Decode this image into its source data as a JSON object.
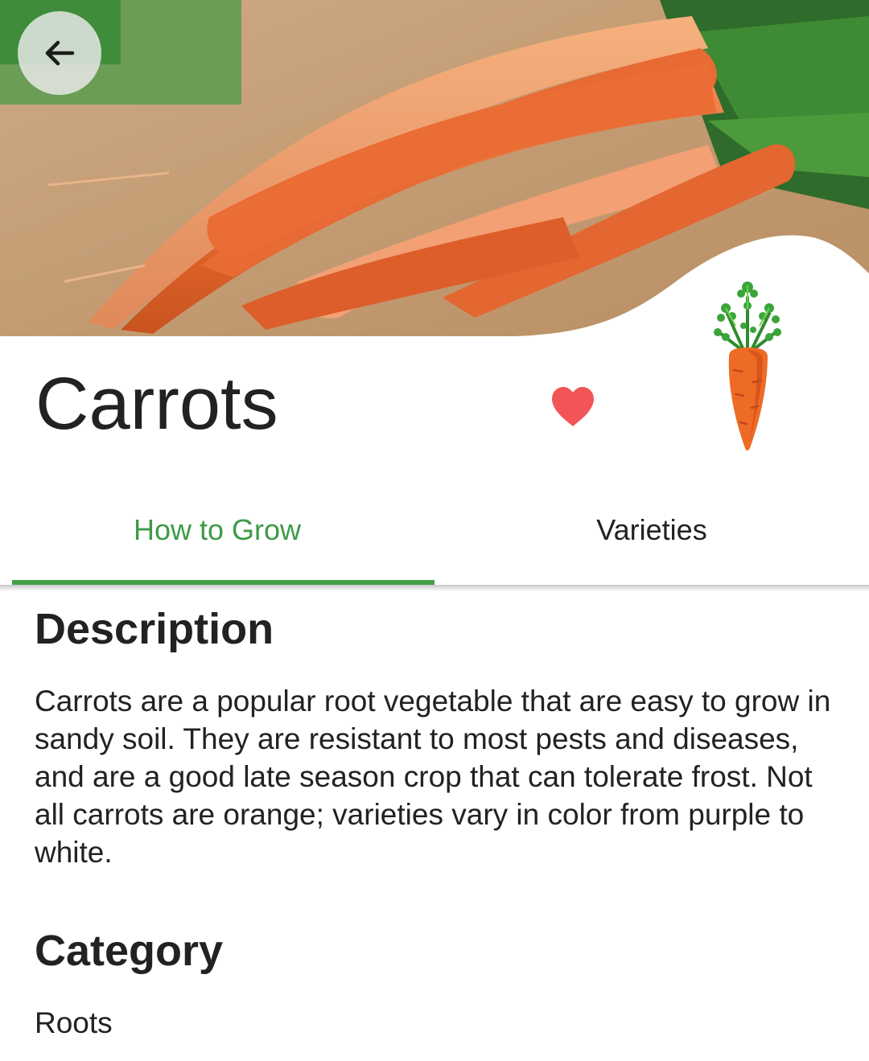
{
  "hero": {
    "image": "carrots-photo",
    "back_icon": "arrow-back-icon"
  },
  "plant": {
    "name": "Carrots",
    "favorite_icon": "heart-icon",
    "favorite_color": "#f25555",
    "plant_icon": "carrot-icon"
  },
  "tabs": [
    {
      "label": "How to Grow",
      "active": true
    },
    {
      "label": "Varieties",
      "active": false
    }
  ],
  "accent_color": "#43a047",
  "content": {
    "description_heading": "Description",
    "description_text": "Carrots are a popular root vegetable that are easy to grow in sandy soil. They are resistant to most pests and diseases, and are a good late season crop that can tolerate frost. Not all carrots are orange; varieties vary in color from purple to white.",
    "category_heading": "Category",
    "category_value": "Roots"
  }
}
